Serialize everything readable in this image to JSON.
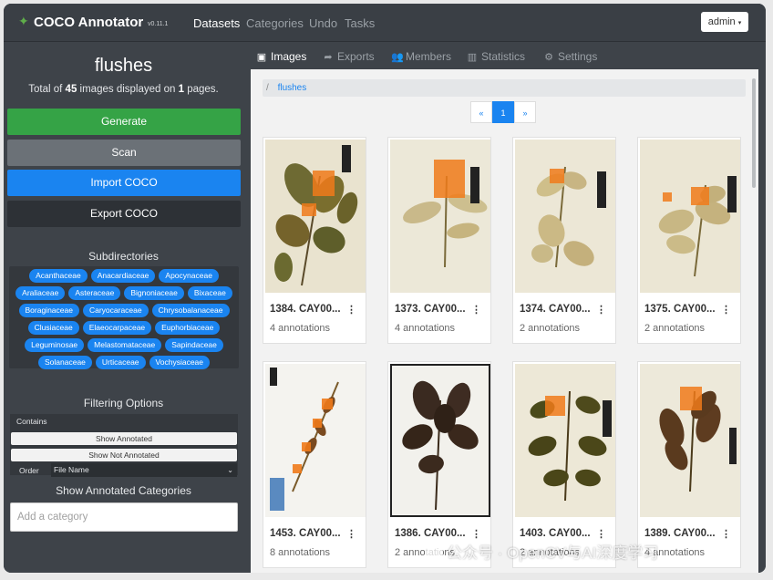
{
  "navbar": {
    "brand": "COCO Annotator",
    "version": "v0.11.1",
    "links": [
      "Datasets",
      "Categories",
      "Undo",
      "Tasks"
    ],
    "user": "admin"
  },
  "sidebar": {
    "folder": "flushes",
    "summary_prefix": "Total of",
    "image_count": "45",
    "summary_middle": "images displayed on",
    "page_count": "1",
    "summary_suffix": "pages.",
    "buttons": [
      "Generate",
      "Scan",
      "Import COCO",
      "Export COCO"
    ],
    "subdirectories_title": "Subdirectories",
    "subdirectories": [
      "Acanthaceae",
      "Anacardiaceae",
      "Apocynaceae",
      "Araliaceae",
      "Asteraceae",
      "Bignoniaceae",
      "Bixaceae",
      "Boraginaceae",
      "Caryocaraceae",
      "Chrysobalanaceae",
      "Clusiaceae",
      "Elaeocarpaceae",
      "Euphorbiaceae",
      "Leguminosae",
      "Melastomataceae",
      "Sapindaceae",
      "Solanaceae",
      "Urticaceae",
      "Vochysiaceae"
    ],
    "filtering_title": "Filtering Options",
    "contains_label": "Contains",
    "show_annotated": "Show Annotated",
    "show_not_annotated": "Show Not Annotated",
    "order_label": "Order",
    "order_value": "File Name",
    "show_categories_title": "Show Annotated Categories",
    "category_placeholder": "Add a category"
  },
  "tabs": [
    "Images",
    "Exports",
    "Members",
    "Statistics",
    "Settings"
  ],
  "breadcrumb": "flushes",
  "pagination": {
    "prev": "«",
    "current": "1",
    "next": "»"
  },
  "images": [
    {
      "title": "1384. CAY00...",
      "annotations": "4 annotations"
    },
    {
      "title": "1373. CAY00...",
      "annotations": "4 annotations"
    },
    {
      "title": "1374. CAY00...",
      "annotations": "2 annotations"
    },
    {
      "title": "1375. CAY00...",
      "annotations": "2 annotations"
    },
    {
      "title": "1453. CAY00...",
      "annotations": "8 annotations"
    },
    {
      "title": "1386. CAY00...",
      "annotations": "2 annotations"
    },
    {
      "title": "1403. CAY00...",
      "annotations": "2 annotations"
    },
    {
      "title": "1389. CAY00...",
      "annotations": "4 annotations"
    }
  ],
  "watermark": "公众号 · OpenCV与AI深度学习",
  "colors": {
    "accent": "#1a84f0",
    "success": "#35a346",
    "sidebar": "#3e4349",
    "annotation": "#f07a1a"
  }
}
